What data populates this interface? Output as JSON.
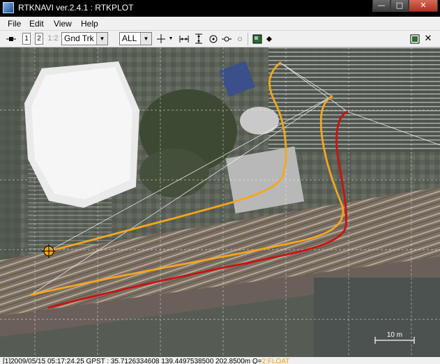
{
  "window": {
    "title": "RTKNAVI ver.2.4.1 : RTKPLOT",
    "buttons": {
      "minimize": "—",
      "maximize": "□",
      "close": "✕"
    }
  },
  "menu": {
    "items": [
      "File",
      "Edit",
      "View",
      "Help"
    ]
  },
  "toolbar": {
    "btn1": "1",
    "btn2": "2",
    "btn12": "1:2",
    "plot_type": "Gnd Trk",
    "sat_filter": "ALL",
    "icons": [
      "connect-icon",
      "crosshair-icon",
      "fit-horizontal-icon",
      "fit-vertical-icon",
      "center-origin-icon",
      "show-track-icon",
      "show-point-icon",
      "show-map-icon",
      "show-marker-icon",
      "show-grid-icon",
      "close-icon"
    ]
  },
  "map": {
    "scale_label": "10 m",
    "track_colors": {
      "track1": "#f4a71d",
      "track2": "#f4a71d",
      "track3": "#cc1111"
    },
    "marker_color": "#f4a71d"
  },
  "status": {
    "text": "[1]2009/05/15 05:17:24.25 GPST : 35.7126334608 139.4497538500 202.8500m Q=",
    "quality": "2:FLOAT"
  }
}
